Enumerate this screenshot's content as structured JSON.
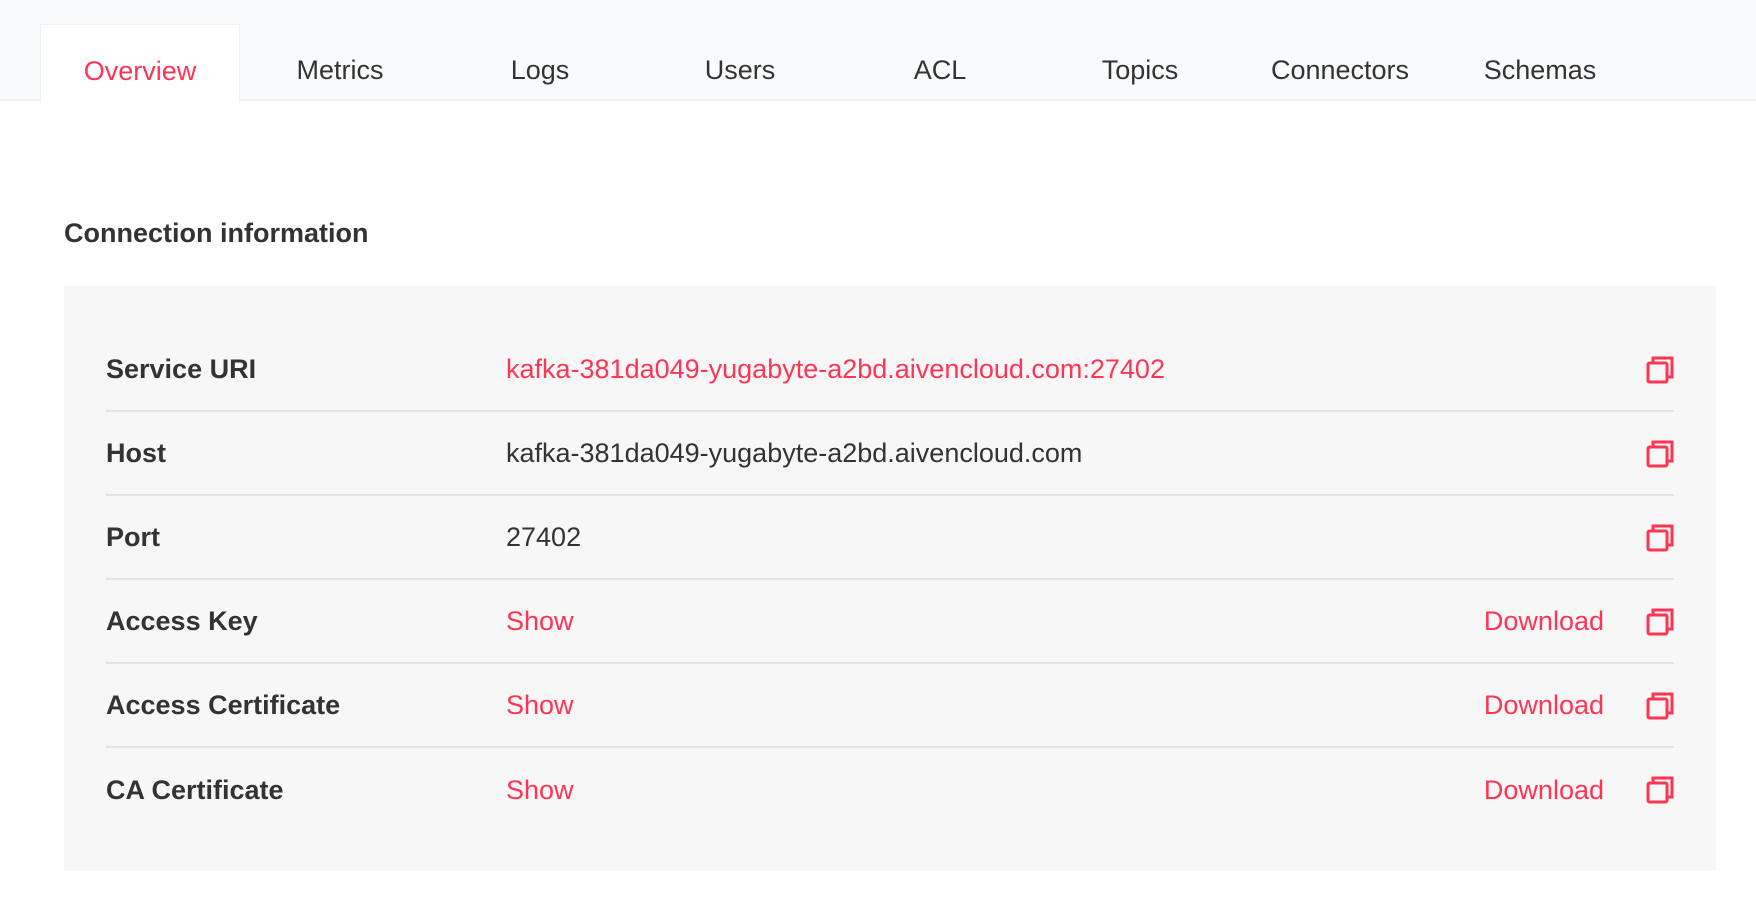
{
  "tabs": [
    {
      "label": "Overview",
      "active": true
    },
    {
      "label": "Metrics"
    },
    {
      "label": "Logs"
    },
    {
      "label": "Users"
    },
    {
      "label": "ACL"
    },
    {
      "label": "Topics"
    },
    {
      "label": "Connectors"
    },
    {
      "label": "Schemas"
    }
  ],
  "section": {
    "title": "Connection information"
  },
  "rows": [
    {
      "label": "Service URI",
      "value": "kafka-381da049-yugabyte-a2bd.aivencloud.com:27402",
      "value_style": "link"
    },
    {
      "label": "Host",
      "value": "kafka-381da049-yugabyte-a2bd.aivencloud.com"
    },
    {
      "label": "Port",
      "value": "27402"
    },
    {
      "label": "Access Key",
      "value": "Show",
      "download": "Download"
    },
    {
      "label": "Access Certificate",
      "value": "Show",
      "download": "Download"
    },
    {
      "label": "CA Certificate",
      "value": "Show",
      "download": "Download"
    }
  ],
  "colors": {
    "accent": "#ff3554",
    "text": "#333333",
    "panel": "#f7f7f7"
  },
  "icons": {
    "copy": "copy-icon"
  }
}
